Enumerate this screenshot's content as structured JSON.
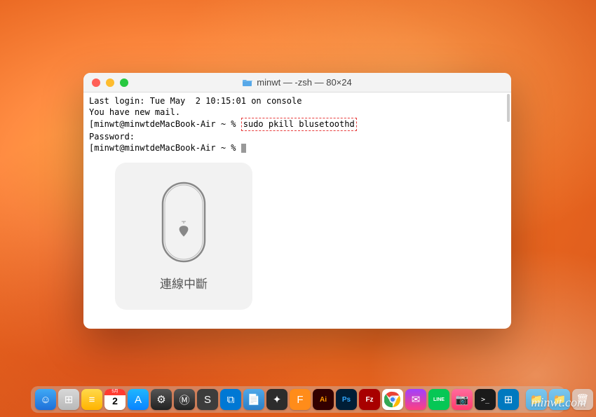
{
  "window": {
    "title": "minwt — -zsh — 80×24"
  },
  "terminal": {
    "line1": "Last login: Tue May  2 10:15:01 on console",
    "line2": "You have new mail.",
    "prompt1_prefix": "[minwt@minwtdeMacBook-Air ~ % ",
    "command": "sudo pkill blusetoothd",
    "line4": "Password:",
    "prompt2": "[minwt@minwtdeMacBook-Air ~ % "
  },
  "overlay": {
    "label": "連線中斷"
  },
  "calendar": {
    "month": "5月",
    "day": "2"
  },
  "dock": {
    "items": [
      {
        "name": "finder",
        "bg": "linear-gradient(#3fa9f5,#1e6fd9)",
        "glyph": "☺"
      },
      {
        "name": "launchpad",
        "bg": "linear-gradient(#d8d8d8,#b8b8b8)",
        "glyph": "⊞"
      },
      {
        "name": "notes-yellow",
        "bg": "linear-gradient(#ffd94a,#ffb300)",
        "glyph": "≡"
      },
      {
        "name": "calendar",
        "bg": "#fff",
        "glyph": ""
      },
      {
        "name": "app-store",
        "bg": "linear-gradient(#1fb6ff,#0a84ff)",
        "glyph": "A"
      },
      {
        "name": "settings",
        "bg": "linear-gradient(#555,#222)",
        "glyph": "⚙"
      },
      {
        "name": "mamp",
        "bg": "linear-gradient(#555,#222)",
        "glyph": "Ⓜ"
      },
      {
        "name": "sublime",
        "bg": "#3c3c3c",
        "glyph": "S"
      },
      {
        "name": "vscode",
        "bg": "#0078d4",
        "glyph": "⧉"
      },
      {
        "name": "notes2",
        "bg": "linear-gradient(#4fa8e8,#2b7fc7)",
        "glyph": "📄"
      },
      {
        "name": "figma",
        "bg": "#2c2c2c",
        "glyph": "✦"
      },
      {
        "name": "forklift",
        "bg": "#ff8c1a",
        "glyph": "F"
      },
      {
        "name": "illustrator",
        "bg": "#330000",
        "glyph": "Ai"
      },
      {
        "name": "photoshop",
        "bg": "#001e36",
        "glyph": "Ps"
      },
      {
        "name": "filezilla",
        "bg": "#a80000",
        "glyph": "Fz"
      },
      {
        "name": "chrome",
        "bg": "#fff",
        "glyph": "◉"
      },
      {
        "name": "messenger",
        "bg": "linear-gradient(#a040ff,#ff4080)",
        "glyph": "✉"
      },
      {
        "name": "line",
        "bg": "#06c755",
        "glyph": "LINE"
      },
      {
        "name": "photobooth",
        "bg": "linear-gradient(#ff6b9d,#ff3b6b)",
        "glyph": "📷"
      },
      {
        "name": "terminal",
        "bg": "#1a1a1a",
        "glyph": ">_"
      },
      {
        "name": "trello",
        "bg": "#0079bf",
        "glyph": "⊞"
      },
      {
        "name": "folder1",
        "bg": "linear-gradient(#7ac6ee,#5ab0e0)",
        "glyph": "📁"
      },
      {
        "name": "folder2",
        "bg": "linear-gradient(#7ac6ee,#5ab0e0)",
        "glyph": "📁"
      },
      {
        "name": "trash",
        "bg": "rgba(220,220,220,0.7)",
        "glyph": "🗑"
      }
    ]
  },
  "watermark": "minwt.com"
}
